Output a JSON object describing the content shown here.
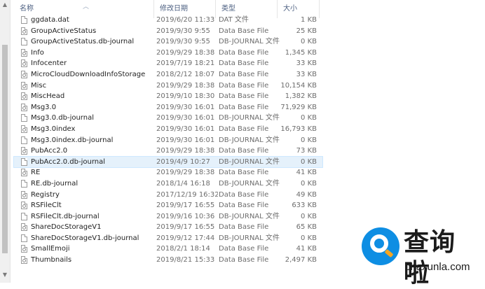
{
  "header": {
    "name": "名称",
    "date": "修改日期",
    "type": "类型",
    "size": "大小",
    "sort_icon": "chevron-up-icon"
  },
  "rows": [
    {
      "name": "ggdata.dat",
      "date": "2019/6/20 11:33",
      "type": "DAT 文件",
      "size": "1 KB",
      "icon": "file-icon"
    },
    {
      "name": "GroupActiveStatus",
      "date": "2019/9/30 9:55",
      "type": "Data Base File",
      "size": "25 KB",
      "icon": "db-file-icon"
    },
    {
      "name": "GroupActiveStatus.db-journal",
      "date": "2019/9/30 9:55",
      "type": "DB-JOURNAL 文件",
      "size": "0 KB",
      "icon": "file-icon"
    },
    {
      "name": "Info",
      "date": "2019/9/29 18:38",
      "type": "Data Base File",
      "size": "1,345 KB",
      "icon": "db-file-icon"
    },
    {
      "name": "Infocenter",
      "date": "2019/7/19 18:21",
      "type": "Data Base File",
      "size": "33 KB",
      "icon": "db-file-icon"
    },
    {
      "name": "MicroCloudDownloadInfoStorage",
      "date": "2018/2/12 18:07",
      "type": "Data Base File",
      "size": "33 KB",
      "icon": "db-file-icon"
    },
    {
      "name": "Misc",
      "date": "2019/9/29 18:38",
      "type": "Data Base File",
      "size": "10,154 KB",
      "icon": "db-file-icon"
    },
    {
      "name": "MiscHead",
      "date": "2019/9/10 18:30",
      "type": "Data Base File",
      "size": "1,382 KB",
      "icon": "db-file-icon"
    },
    {
      "name": "Msg3.0",
      "date": "2019/9/30 16:01",
      "type": "Data Base File",
      "size": "71,929 KB",
      "icon": "db-file-icon"
    },
    {
      "name": "Msg3.0.db-journal",
      "date": "2019/9/30 16:01",
      "type": "DB-JOURNAL 文件",
      "size": "0 KB",
      "icon": "file-icon"
    },
    {
      "name": "Msg3.0index",
      "date": "2019/9/30 16:01",
      "type": "Data Base File",
      "size": "16,793 KB",
      "icon": "db-file-icon"
    },
    {
      "name": "Msg3.0index.db-journal",
      "date": "2019/9/30 16:01",
      "type": "DB-JOURNAL 文件",
      "size": "0 KB",
      "icon": "file-icon"
    },
    {
      "name": "PubAcc2.0",
      "date": "2019/9/29 18:38",
      "type": "Data Base File",
      "size": "73 KB",
      "icon": "db-file-icon"
    },
    {
      "name": "PubAcc2.0.db-journal",
      "date": "2019/4/9 10:27",
      "type": "DB-JOURNAL 文件",
      "size": "0 KB",
      "icon": "file-icon",
      "selected": true
    },
    {
      "name": "RE",
      "date": "2019/9/29 18:38",
      "type": "Data Base File",
      "size": "41 KB",
      "icon": "db-file-icon"
    },
    {
      "name": "RE.db-journal",
      "date": "2018/1/4 16:18",
      "type": "DB-JOURNAL 文件",
      "size": "0 KB",
      "icon": "file-icon"
    },
    {
      "name": "Registry",
      "date": "2017/12/19 16:32",
      "type": "Data Base File",
      "size": "49 KB",
      "icon": "db-file-icon"
    },
    {
      "name": "RSFileClt",
      "date": "2019/9/17 16:55",
      "type": "Data Base File",
      "size": "633 KB",
      "icon": "db-file-icon"
    },
    {
      "name": "RSFileClt.db-journal",
      "date": "2019/9/16 10:36",
      "type": "DB-JOURNAL 文件",
      "size": "0 KB",
      "icon": "file-icon"
    },
    {
      "name": "ShareDocStorageV1",
      "date": "2019/9/17 16:55",
      "type": "Data Base File",
      "size": "65 KB",
      "icon": "db-file-icon"
    },
    {
      "name": "ShareDocStorageV1.db-journal",
      "date": "2019/9/12 17:44",
      "type": "DB-JOURNAL 文件",
      "size": "0 KB",
      "icon": "file-icon"
    },
    {
      "name": "SmallEmoji",
      "date": "2018/2/1 18:14",
      "type": "Data Base File",
      "size": "41 KB",
      "icon": "db-file-icon"
    },
    {
      "name": "Thumbnails",
      "date": "2019/8/21 15:33",
      "type": "Data Base File",
      "size": "2,497 KB",
      "icon": "db-file-icon"
    }
  ],
  "watermark": {
    "brand": "查询啦",
    "domain": "chaxunla.com",
    "colors": {
      "blue": "#0e8ee3",
      "orange": "#f5a623"
    }
  },
  "colors": {
    "header_text": "#4d6082",
    "selected_row": "#e5f1fb",
    "secondary_text": "#6d6d6d"
  }
}
